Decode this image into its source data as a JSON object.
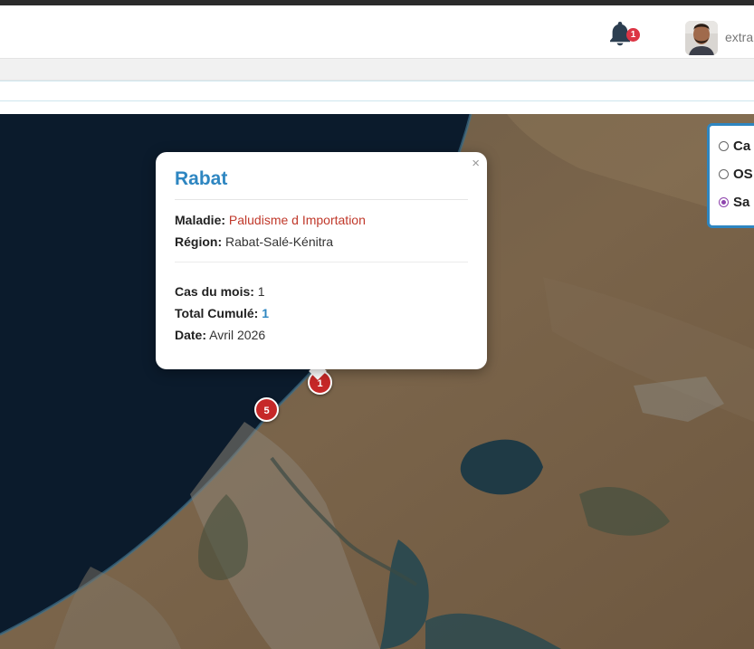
{
  "header": {
    "notification_count": "1",
    "username": "extra"
  },
  "map": {
    "markers": [
      {
        "label": "1"
      },
      {
        "label": "5"
      }
    ],
    "popup": {
      "close_glyph": "×",
      "title": "Rabat",
      "disease_label": "Maladie:",
      "disease_value": "Paludisme d Importation",
      "region_label": "Région:",
      "region_value": "Rabat-Salé-Kénitra",
      "cases_label": "Cas du mois:",
      "cases_value": "1",
      "total_label": "Total Cumulé:",
      "total_value": "1",
      "date_label": "Date:",
      "date_value": "Avril 2026"
    },
    "layers": {
      "options": [
        {
          "label": "Ca",
          "selected": false
        },
        {
          "label": "OS",
          "selected": false
        },
        {
          "label": "Sa",
          "selected": true
        }
      ]
    }
  },
  "colors": {
    "accent": "#2e86c1",
    "marker": "#c62828",
    "disease_text": "#c0392b",
    "radio_selected": "#8e44ad",
    "sea": "#0b1b2c",
    "land": "#6b5b45"
  },
  "icons": [
    "bell-icon",
    "avatar",
    "close-icon",
    "radio-icon"
  ]
}
